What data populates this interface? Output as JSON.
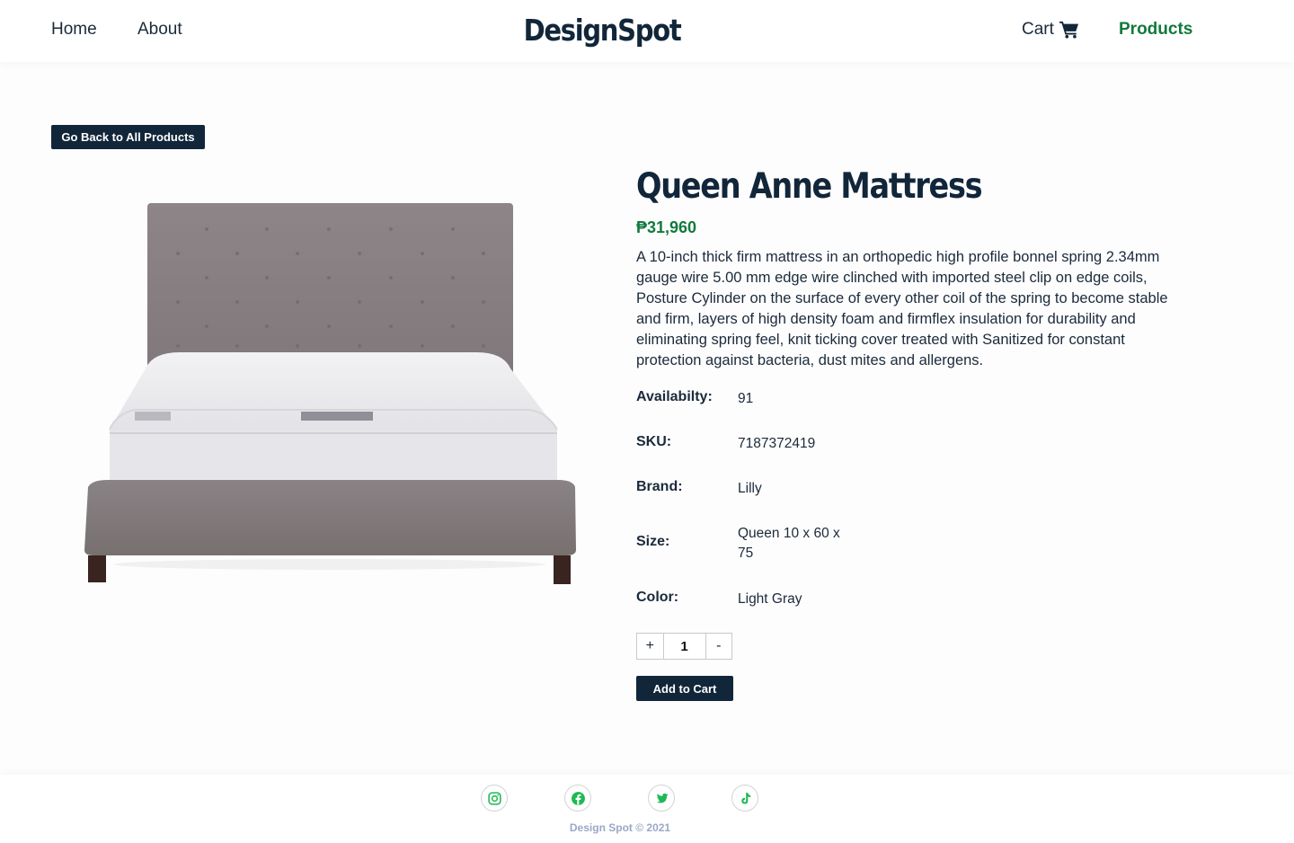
{
  "nav": {
    "home": "Home",
    "about": "About",
    "brand": "DesignSpot",
    "cart": "Cart",
    "products": "Products"
  },
  "back_button": "Go Back to All Products",
  "product": {
    "title": "Queen Anne Mattress",
    "price": "₱31,960",
    "description": "A 10-inch thick firm mattress in an orthopedic high profile bonnel spring 2.34mm gauge wire 5.00 mm edge wire clinched with imported steel clip on edge coils, Posture Cylinder on the surface of every other coil of the spring to become stable and firm, layers of high density foam and firmflex insulation for durability and eliminating spring feel, knit ticking cover treated with Sanitized for constant protection against bacteria, dust mites and allergens.",
    "specs": {
      "availability": {
        "label": "Availabilty:",
        "value": "91"
      },
      "sku": {
        "label": "SKU:",
        "value": "7187372419"
      },
      "brand": {
        "label": "Brand:",
        "value": "Lilly"
      },
      "size": {
        "label": "Size:",
        "value": "Queen 10 x 60 x 75"
      },
      "color": {
        "label": "Color:",
        "value": "Light Gray"
      }
    },
    "quantity": {
      "plus": "+",
      "value": "1",
      "minus": "-"
    },
    "add_to_cart": "Add to Cart",
    "image_alt": "gray-upholstered-bed-with-white-mattress"
  },
  "footer": {
    "social_icons": [
      "instagram-icon",
      "facebook-icon",
      "twitter-icon",
      "tiktok-icon"
    ],
    "copyright": "Design Spot © 2021"
  },
  "colors": {
    "primary": "#12263a",
    "accent": "#117a3c",
    "social": "#1db954"
  }
}
